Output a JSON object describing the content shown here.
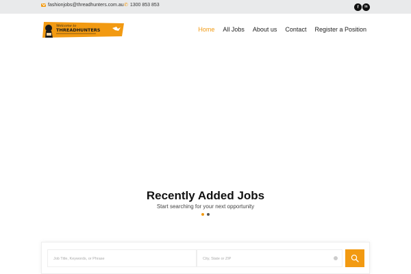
{
  "topbar": {
    "email": "fashionjobs@threadhunters.com.au",
    "phone": "1300 853 853",
    "social": [
      {
        "label": "f",
        "icon": "facebook-icon"
      },
      {
        "label": "in",
        "icon": "linkedin-icon"
      }
    ]
  },
  "header": {
    "logo": {
      "script_text": "Welcome to",
      "brand_text": "THREADHUNTERS",
      "colors": {
        "background": "#f29a12",
        "dark": "#1a1a1a"
      }
    },
    "nav": [
      {
        "label": "Home",
        "active": true
      },
      {
        "label": "All Jobs",
        "active": false
      },
      {
        "label": "About us",
        "active": false
      },
      {
        "label": "Contact",
        "active": false
      },
      {
        "label": "Register a Position",
        "active": false
      }
    ]
  },
  "hero": {
    "title": "Recently Added Jobs",
    "subtitle": "Start searching for your next opportunity",
    "slides_total": 2,
    "active_slide": 1
  },
  "search": {
    "keyword_placeholder": "Job Title, Keywords, or Phrase",
    "location_placeholder": "City, State or ZIP"
  },
  "colors": {
    "accent": "#f29a12",
    "topbar_bg": "#e9eaeb",
    "text": "#222222"
  }
}
